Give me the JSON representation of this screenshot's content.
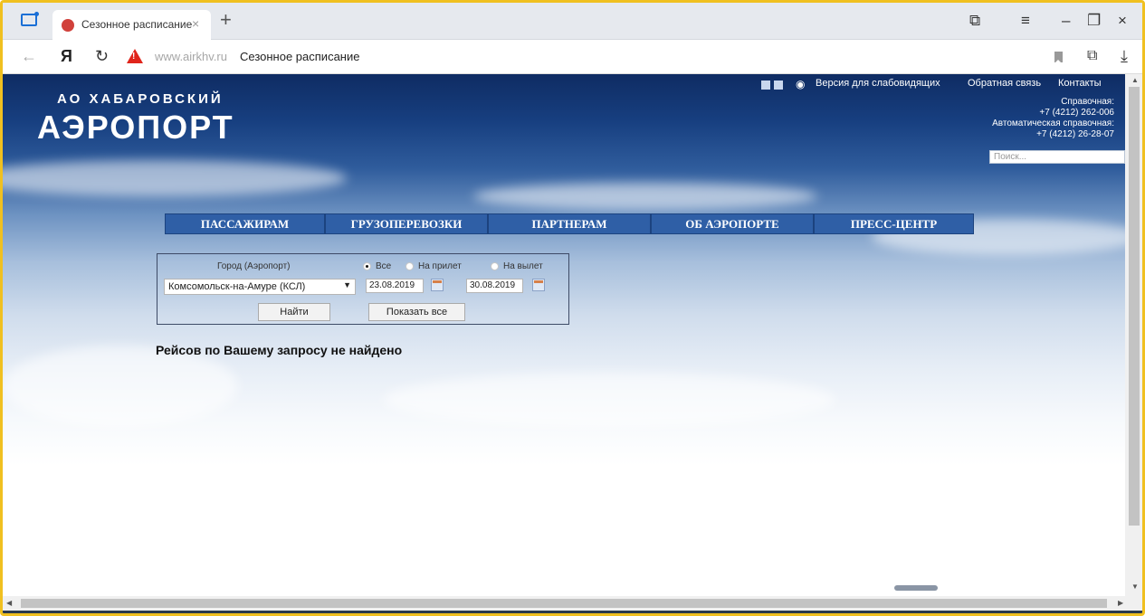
{
  "browser": {
    "tab_title": "Сезонное расписание",
    "tab_close": "×",
    "new_tab": "+",
    "url_domain": "www.airkhv.ru",
    "url_title": "Сезонное расписание",
    "window_controls": [
      "⧉",
      "≡",
      "–",
      "❐",
      "×"
    ]
  },
  "header": {
    "logo_line1": "АО ХАБАРОВСКИЙ",
    "logo_line2": "АЭРОПОРТ",
    "accessibility_link": "Версия для слабовидящих",
    "feedback_link": "Обратная связь",
    "contacts_link": "Контакты",
    "helpline_label": "Справочная:",
    "helpline_phone": "+7 (4212) 262-006",
    "auto_helpline_label": "Автоматическая справочная:",
    "auto_helpline_phone": "+7 (4212) 26-28-07",
    "search_placeholder": "Поиск..."
  },
  "menu": [
    "ПАССАЖИРАМ",
    "ГРУЗОПЕРЕВОЗКИ",
    "ПАРТНЕРАМ",
    "ОБ АЭРОПОРТЕ",
    "ПРЕСС-ЦЕНТР"
  ],
  "form": {
    "city_label": "Город (Аэропорт)",
    "radio_all": "Все",
    "radio_arrival": "На прилет",
    "radio_departure": "На вылет",
    "selected_radio": "Все",
    "city_value": "Комсомольск-на-Амуре (КСЛ)",
    "date_from": "23.08.2019",
    "date_to": "30.08.2019",
    "find_button": "Найти",
    "show_all_button": "Показать все"
  },
  "result_message": "Рейсов по Вашему запросу не найдено",
  "colors": {
    "menu_bg": "#2f5fa6",
    "sky_top": "#0f2c63",
    "frame_border": "#f0c020"
  }
}
